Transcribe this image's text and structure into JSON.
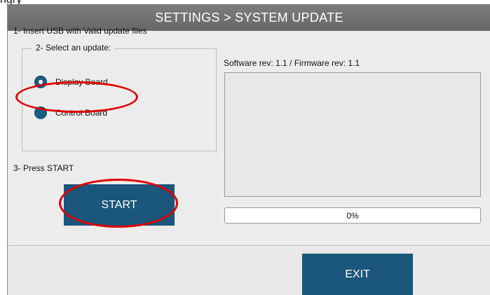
{
  "crop_text": "ngry",
  "window": {
    "title": "SETTINGS > SYSTEM UPDATE"
  },
  "steps": {
    "insert_usb": "1- Insert USB with Valid update files",
    "select_update": "2- Select an update:",
    "press_start": "3- Press START"
  },
  "update_options": [
    {
      "label": "Display Board",
      "selected": true
    },
    {
      "label": "Control Board",
      "selected": false
    }
  ],
  "revision_text": "Software rev: 1.1  /  Firmware rev: 1.1",
  "log_text": "",
  "progress": {
    "percent": 0,
    "label": "0%"
  },
  "buttons": {
    "start_label": "START",
    "exit_label": "EXIT"
  },
  "colors": {
    "accent": "#1b567c",
    "annotation": "#e00000",
    "titlebar": "#707070"
  }
}
